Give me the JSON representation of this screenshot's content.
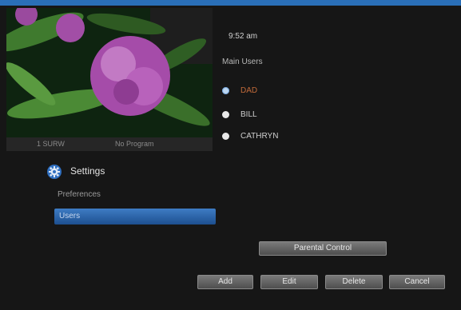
{
  "status": {
    "channel": "1 SURW",
    "program": "No Program"
  },
  "clock": "9:52 am",
  "users": {
    "heading": "Main Users",
    "items": [
      {
        "name": "DAD",
        "selected": true
      },
      {
        "name": "BILL",
        "selected": false
      },
      {
        "name": "CATHRYN",
        "selected": false
      }
    ]
  },
  "settings": {
    "title": "Settings",
    "icon": "gear-icon",
    "menu": [
      {
        "label": "Preferences",
        "selected": false
      },
      {
        "label": "Users",
        "selected": true
      }
    ]
  },
  "buttons": {
    "parental_control": "Parental Control",
    "add": "Add",
    "edit": "Edit",
    "delete": "Delete",
    "cancel": "Cancel"
  },
  "colors": {
    "accent": "#2a6fb8",
    "selection": "#2f69b0",
    "selected_user_text": "#c26a3a"
  }
}
